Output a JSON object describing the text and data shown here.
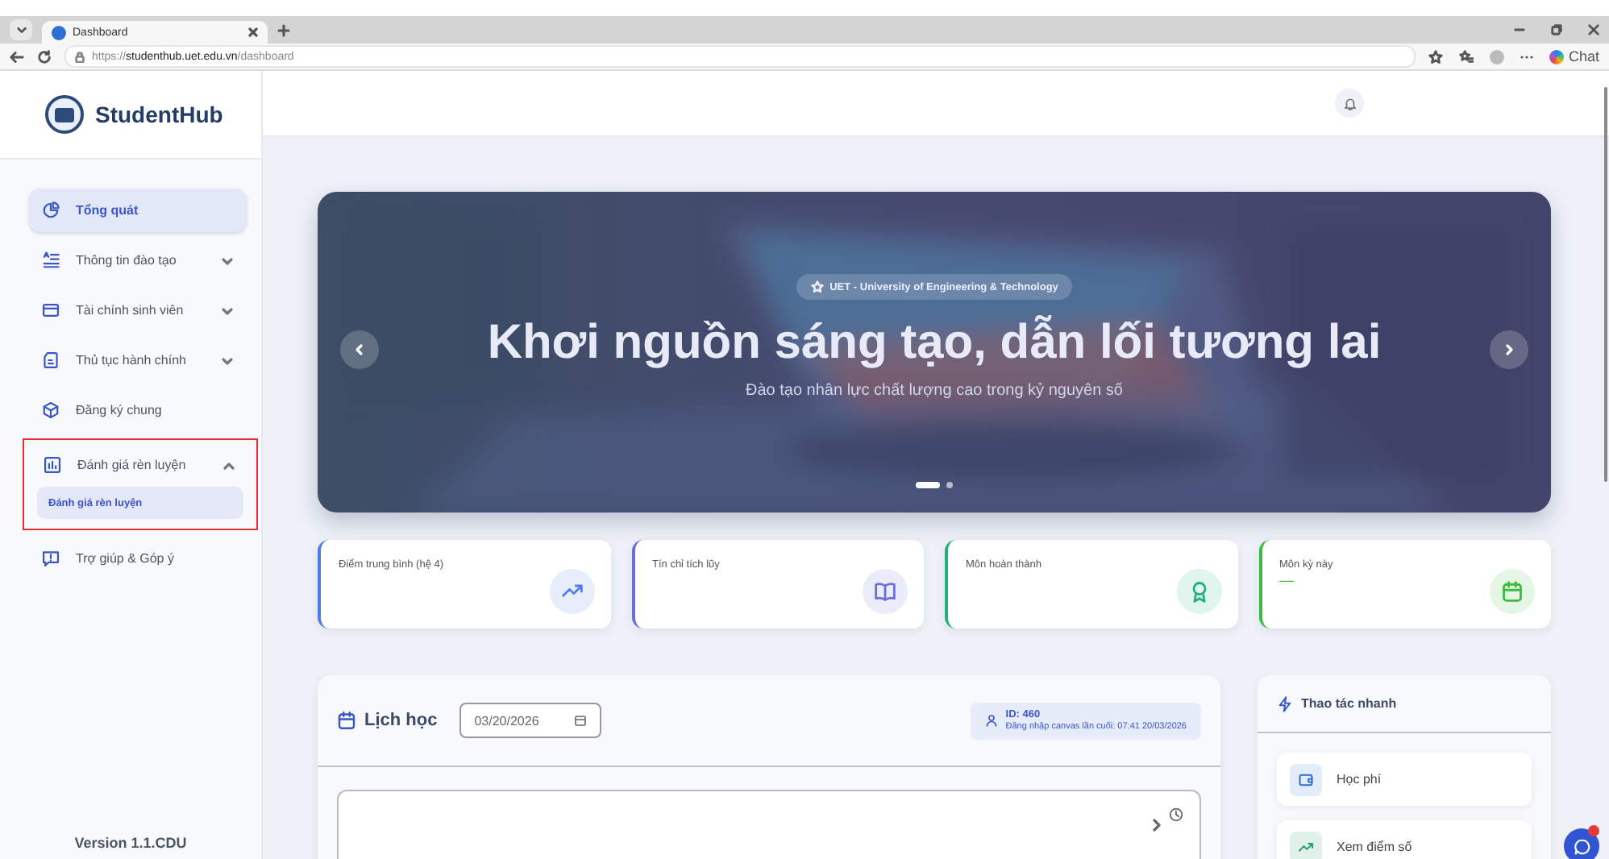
{
  "browser": {
    "tab_title": "Dashboard",
    "url": "https://**studenthub.uet.edu.vn**/dashboard",
    "copilot_label": "Chat"
  },
  "sidebar": {
    "brand": "StudentHub",
    "items": [
      {
        "label": "Tổng quát",
        "kind": "link",
        "selected": true,
        "annotated": false
      },
      {
        "label": "Thông tin đào tạo",
        "kind": "group",
        "expanded": false,
        "selected": false,
        "annotated": false
      },
      {
        "label": "Tài chính sinh viên",
        "kind": "group",
        "expanded": false,
        "selected": false,
        "annotated": false
      },
      {
        "label": "Thủ tục hành chính",
        "kind": "group",
        "expanded": false,
        "selected": false,
        "annotated": false
      },
      {
        "label": "Đăng ký chung",
        "kind": "link",
        "selected": false,
        "annotated": false
      },
      {
        "label": "Đánh giá rèn luyện",
        "kind": "group",
        "expanded": true,
        "selected": false,
        "annotated": true,
        "children": [
          {
            "label": "Đánh giá rèn luyện",
            "selected": true
          }
        ]
      },
      {
        "label": "Trợ giúp & Góp ý",
        "kind": "link",
        "selected": false,
        "annotated": false
      }
    ],
    "version": "Version 1.1.CDU"
  },
  "banner": {
    "badge": "UET - University of Engineering & Technology",
    "title": "Khơi nguồn sáng tạo, dẫn lối tương lai",
    "subtitle": "Đào tạo nhân lực chất lượng cao trong kỷ nguyên số",
    "slides": [
      {
        "selected": true
      },
      {
        "selected": false
      }
    ]
  },
  "stats": [
    {
      "label": "Điểm trung bình (hệ 4)",
      "color": "#4f7be8"
    },
    {
      "label": "Tín chỉ tích lũy",
      "color": "#6b6fd6"
    },
    {
      "label": "Môn hoàn thành",
      "color": "#22b07d"
    },
    {
      "label": "Môn kỳ này",
      "value": "—",
      "color": "#3dbb3d"
    }
  ],
  "schedule": {
    "title": "Lịch học",
    "date": "03/20/2026",
    "user_id": "ID: 460",
    "last_login": "Đăng nhập canvas lần cuối: 07:41 20/03/2026"
  },
  "quick_actions": {
    "title": "Thao tác nhanh",
    "items": [
      {
        "label": "Học phí"
      },
      {
        "label": "Xem điểm số"
      }
    ]
  }
}
